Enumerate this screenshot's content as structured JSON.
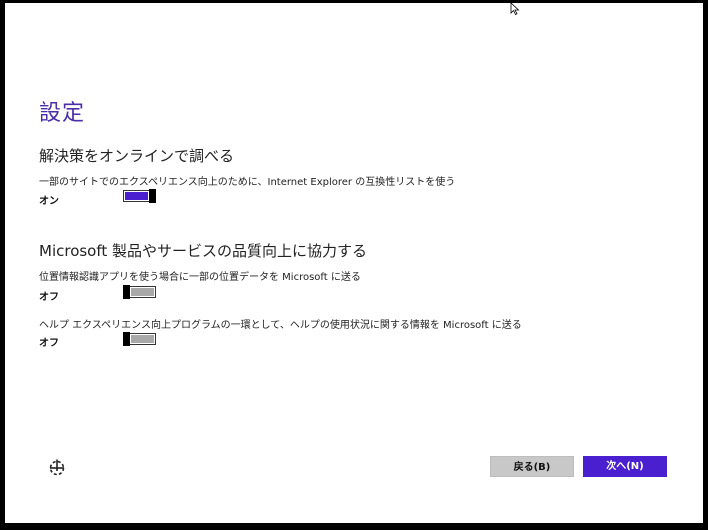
{
  "page": {
    "title": "設定"
  },
  "section1": {
    "heading": "解決策をオンラインで調べる",
    "items": [
      {
        "description": "一部のサイトでのエクスペリエンス向上のために、Internet Explorer の互換性リストを使う",
        "state_label": "オン",
        "enabled": true
      }
    ]
  },
  "section2": {
    "heading": "Microsoft 製品やサービスの品質向上に協力する",
    "items": [
      {
        "description": "位置情報認識アプリを使う場合に一部の位置データを Microsoft に送る",
        "state_label": "オフ",
        "enabled": false
      },
      {
        "description": "ヘルプ エクスペリエンス向上プログラムの一環として、ヘルプの使用状況に関する情報を Microsoft に送る",
        "state_label": "オフ",
        "enabled": false
      }
    ]
  },
  "footer": {
    "accessibility_icon": "ease-of-access-icon",
    "back_label": "戻る(B)",
    "next_label": "次へ(N)"
  },
  "colors": {
    "accent": "#4a1fd0",
    "title": "#4b2fa8",
    "toggle_off": "#a8a8a8"
  }
}
